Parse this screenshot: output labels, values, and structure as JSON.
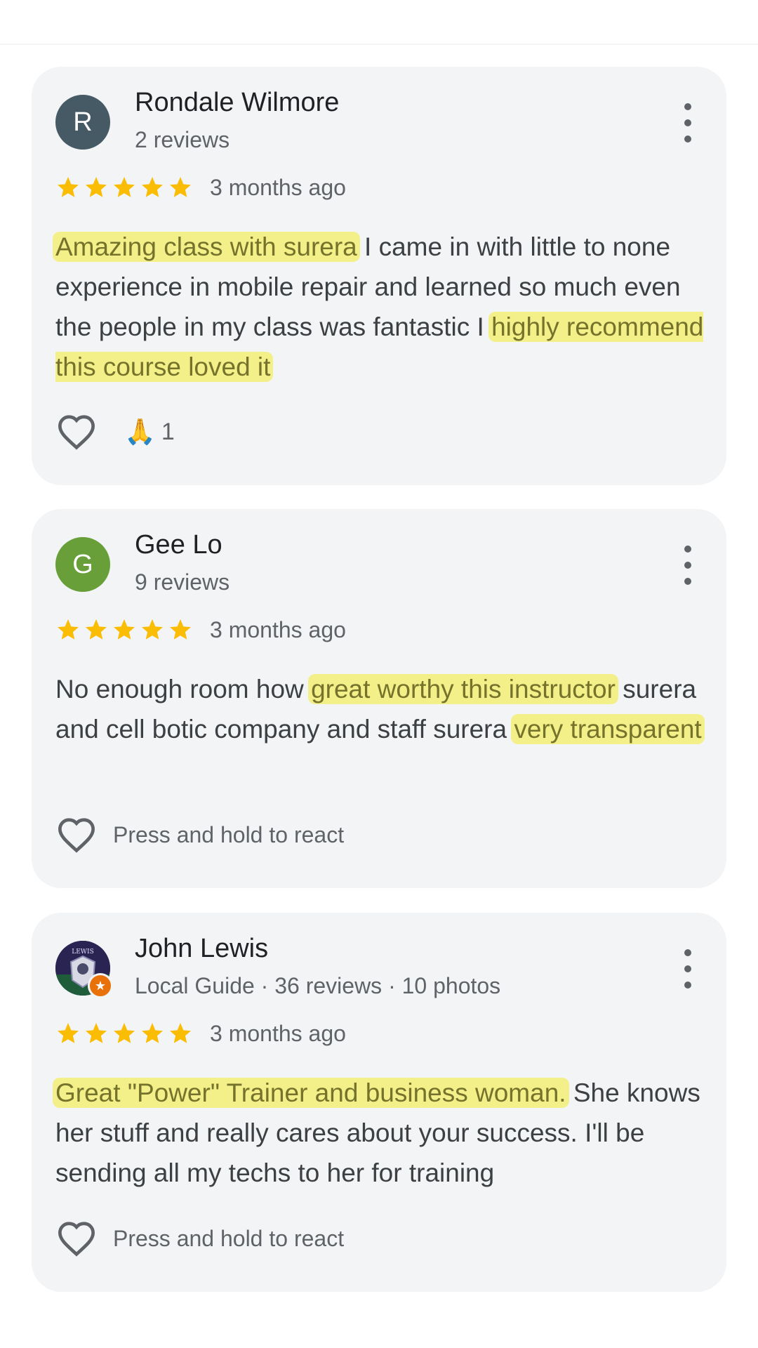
{
  "reviews": [
    {
      "avatar_letter": "R",
      "avatar_color": "#455a64",
      "name": "Rondale Wilmore",
      "meta": "2 reviews",
      "rating": 5,
      "time": "3 months ago",
      "text_parts": [
        {
          "text": "Amazing class with surera",
          "highlighted": true
        },
        {
          "text": " I came in with little to none experience in mobile repair and learned so much even the people in my class was fantastic I ",
          "highlighted": false
        },
        {
          "text": "highly recommend this course loved it",
          "highlighted": true
        }
      ],
      "reaction_emoji": "🙏",
      "reaction_count": "1"
    },
    {
      "avatar_letter": "G",
      "avatar_color": "#689f38",
      "name": "Gee Lo",
      "meta": "9 reviews",
      "rating": 5,
      "time": "3 months ago",
      "text_parts": [
        {
          "text": "No enough room how ",
          "highlighted": false
        },
        {
          "text": "great worthy this instructor",
          "highlighted": true
        },
        {
          "text": " surera and cell botic company and staff surera ",
          "highlighted": false
        },
        {
          "text": "very transparent",
          "highlighted": true
        }
      ],
      "react_hint": "Press and hold to react"
    },
    {
      "avatar_image": "local-guide-profile-photo",
      "avatar_photo_text": "LEWIS",
      "badge_icon": "local-guide-star-badge",
      "name": "John Lewis",
      "meta": "Local Guide · 36 reviews · 10 photos",
      "rating": 5,
      "time": "3 months ago",
      "text_parts": [
        {
          "text": "Great \"Power\" Trainer and business woman.",
          "highlighted": true
        },
        {
          "text": " She knows her stuff and really cares about your success. I'll be sending all my techs to her for training",
          "highlighted": false
        }
      ],
      "react_hint": "Press and hold to react"
    }
  ],
  "colors": {
    "card_background": "#f3f4f6",
    "star": "#fbbc04",
    "highlight": "#f3f08a",
    "highlight_text": "#75732b"
  },
  "icons": {
    "star": "star-icon",
    "more": "more-vert-icon",
    "heart": "heart-outline-icon"
  }
}
